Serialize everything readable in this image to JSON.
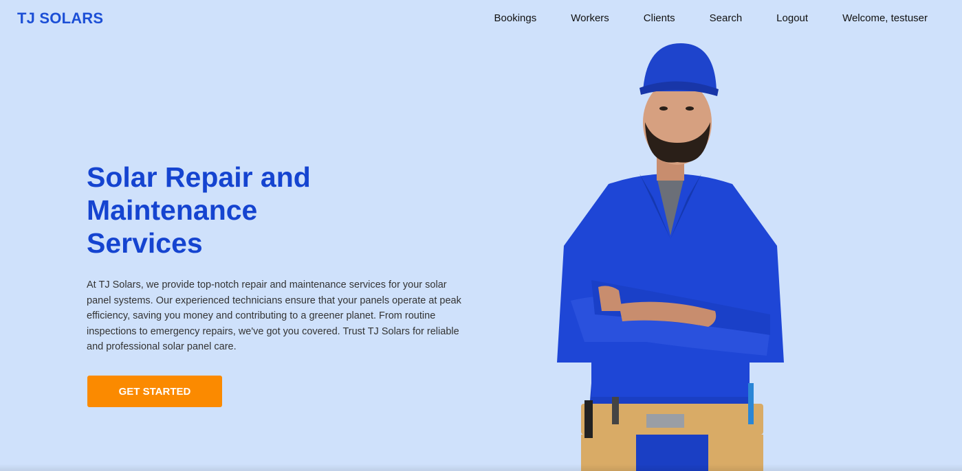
{
  "header": {
    "brand": "TJ SOLARS",
    "nav": {
      "bookings": "Bookings",
      "workers": "Workers",
      "clients": "Clients",
      "search": "Search",
      "logout": "Logout",
      "welcome": "Welcome, testuser"
    }
  },
  "hero": {
    "title": "Solar Repair and Maintenance Services",
    "text": "At TJ Solars, we provide top-notch repair and maintenance services for your solar panel systems. Our experienced technicians ensure that your panels operate at peak efficiency, saving you money and contributing to a greener planet. From routine inspections to emergency repairs, we've got you covered. Trust TJ Solars for reliable and professional solar panel care.",
    "cta_label": "GET STARTED"
  },
  "colors": {
    "background": "#cfe1fb",
    "brand": "#1c4fd6",
    "title": "#1544d0",
    "cta": "#fb8a00"
  }
}
